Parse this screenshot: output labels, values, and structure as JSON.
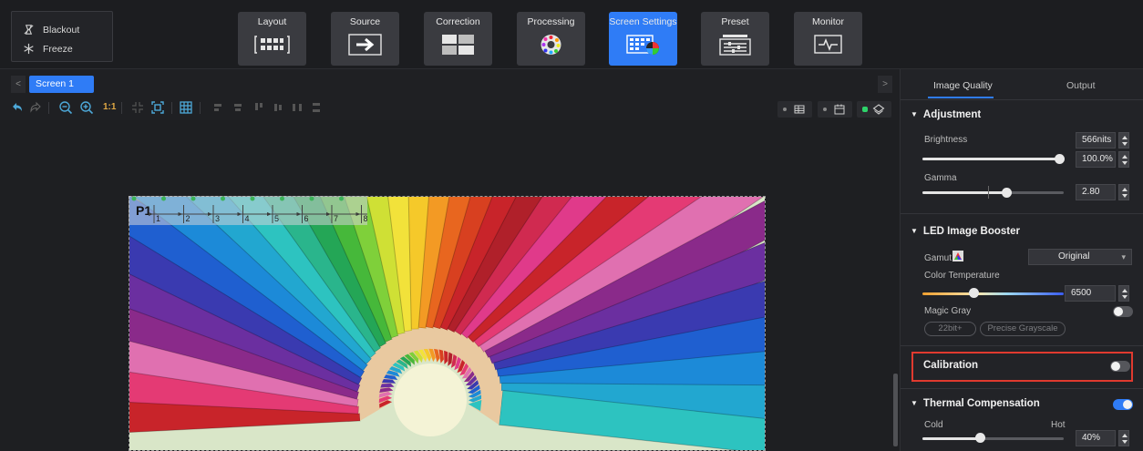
{
  "top": {
    "blackout_label": "Blackout",
    "freeze_label": "Freeze",
    "modes": [
      {
        "label": "Layout"
      },
      {
        "label": "Source"
      },
      {
        "label": "Correction"
      },
      {
        "label": "Processing"
      },
      {
        "label": "Screen Settings"
      },
      {
        "label": "Preset"
      },
      {
        "label": "Monitor"
      }
    ],
    "active_mode": "Screen Settings"
  },
  "canvas": {
    "screen_tab": "Screen 1",
    "zoom_label": "1:1",
    "ruler_label": "P1",
    "ruler_ticks": [
      "1",
      "2",
      "3",
      "4",
      "5",
      "6",
      "7",
      "8"
    ]
  },
  "panel": {
    "tabs": [
      "Image Quality",
      "Output"
    ],
    "active_tab": "Image Quality",
    "adjustment": {
      "title": "Adjustment",
      "brightness_label": "Brightness",
      "brightness_nits": "566nits",
      "brightness_pct": "100.0%",
      "brightness_value": 1.0,
      "gamma_label": "Gamma",
      "gamma_value": "2.80"
    },
    "booster": {
      "title": "LED Image Booster",
      "gamut_label": "Gamut",
      "gamut_value": "Original",
      "color_temp_label": "Color Temperature",
      "color_temp_value": "6500",
      "magic_gray_label": "Magic Gray",
      "magic_gray_on": false,
      "pill1": "22bit+",
      "pill2": "Precise Grayscale"
    },
    "calibration": {
      "title": "Calibration",
      "on": false
    },
    "thermal": {
      "title": "Thermal Compensation",
      "on": true,
      "cold_label": "Cold",
      "hot_label": "Hot",
      "value": "40%"
    }
  },
  "colors": {
    "accent": "#2f7cf6",
    "highlight": "#e03a2f"
  }
}
